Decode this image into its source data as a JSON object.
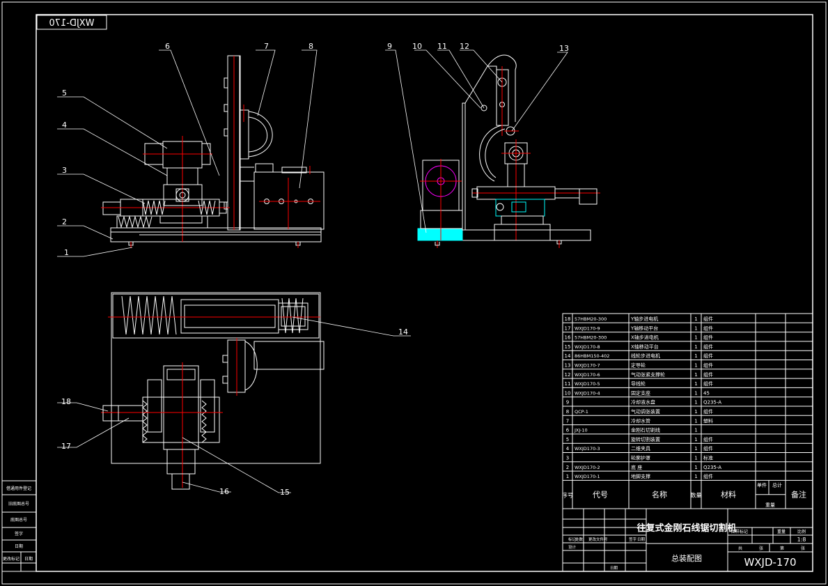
{
  "drawing": {
    "code_mirrored": "WXJD-170",
    "code": "WXJD-170",
    "title": "往复式金刚石线锯切割机",
    "subtitle": "总装配图",
    "scale": "1:8",
    "header_labels": [
      "图样标记",
      "重量",
      "比例"
    ],
    "sheet_labels": [
      "共",
      "张",
      "第",
      "张"
    ],
    "sign_labels": [
      "标记",
      "处数",
      "更改文件号",
      "签字",
      "日期",
      "设计",
      "日期"
    ]
  },
  "balloons": [
    "1",
    "2",
    "3",
    "4",
    "5",
    "6",
    "7",
    "8",
    "9",
    "10",
    "11",
    "12",
    "13",
    "14",
    "15",
    "16",
    "17",
    "18"
  ],
  "bom": {
    "headers": [
      "序号",
      "代号",
      "名称",
      "数量",
      "材料",
      "单件",
      "总计",
      "重量",
      "备注"
    ],
    "rows": [
      {
        "no": "18",
        "code": "57HBM20-300",
        "name": "Y轴步进电机",
        "qty": "1",
        "mat": "组件"
      },
      {
        "no": "17",
        "code": "WXJD170-9",
        "name": "Y轴移动平台",
        "qty": "1",
        "mat": "组件"
      },
      {
        "no": "16",
        "code": "57HBM20-300",
        "name": "X轴步进电机",
        "qty": "1",
        "mat": "组件"
      },
      {
        "no": "15",
        "code": "WXJD170-8",
        "name": "X轴移动平台",
        "qty": "1",
        "mat": "组件"
      },
      {
        "no": "14",
        "code": "86HBM150-402",
        "name": "线轮步进电机",
        "qty": "1",
        "mat": "组件"
      },
      {
        "no": "13",
        "code": "WXJD170-7",
        "name": "定导轮",
        "qty": "1",
        "mat": "组件"
      },
      {
        "no": "12",
        "code": "WXJD170-6",
        "name": "气动张紧支撑轮",
        "qty": "1",
        "mat": "组件"
      },
      {
        "no": "11",
        "code": "WXJD170-5",
        "name": "导线轮",
        "qty": "1",
        "mat": "组件"
      },
      {
        "no": "10",
        "code": "WXJD170-4",
        "name": "固定支座",
        "qty": "1",
        "mat": "45"
      },
      {
        "no": "9",
        "code": "",
        "name": "冷却液水盘",
        "qty": "1",
        "mat": "Q235-A"
      },
      {
        "no": "8",
        "code": "QCP-1",
        "name": "气动调张装置",
        "qty": "1",
        "mat": "组件"
      },
      {
        "no": "7",
        "code": "",
        "name": "冷却水管",
        "qty": "1",
        "mat": "塑料"
      },
      {
        "no": "6",
        "code": "JXJ-10",
        "name": "金刚石切割线",
        "qty": "1",
        "mat": ""
      },
      {
        "no": "5",
        "code": "",
        "name": "旋转切割装置",
        "qty": "1",
        "mat": "组件"
      },
      {
        "no": "4",
        "code": "WXJD170-3",
        "name": "二维夹具",
        "qty": "1",
        "mat": "组件"
      },
      {
        "no": "3",
        "code": "",
        "name": "轮廓护罩",
        "qty": "1",
        "mat": "标准"
      },
      {
        "no": "2",
        "code": "WXJD170-2",
        "name": "底 座",
        "qty": "1",
        "mat": "Q235-A"
      },
      {
        "no": "1",
        "code": "WXJD170-1",
        "name": "地脚支撑",
        "qty": "1",
        "mat": "组件"
      }
    ]
  },
  "revision_block": {
    "labels": [
      "借通用件登记",
      "旧底图总号",
      "底图总号",
      "签字",
      "日期",
      "更改标记",
      "日期"
    ]
  },
  "colors": {
    "background": "#000000",
    "outline": "#ffffff",
    "centerline": "#ff0000",
    "wheel": "#ff00ff",
    "coolant": "#00ffff"
  }
}
